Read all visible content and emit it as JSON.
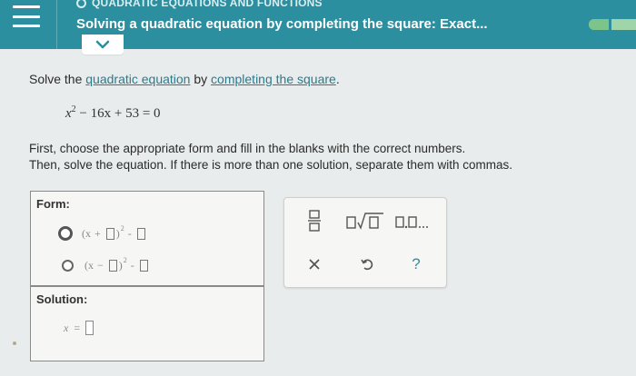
{
  "header": {
    "topic": "QUADRATIC EQUATIONS AND FUNCTIONS",
    "title": "Solving a quadratic equation by completing the square: Exact...",
    "progress": 0.35,
    "colors": {
      "bar": "#2b8fa0",
      "progress": "#7cc489"
    }
  },
  "problem": {
    "instruction_prefix": "Solve the",
    "link1": "quadratic equation",
    "instruction_mid": "by",
    "link2": "completing the square",
    "instruction_suffix": ".",
    "equation": {
      "var": "x",
      "exp": "2",
      "rest": "− 16x + 53 = 0"
    },
    "directions_line1": "First, choose the appropriate form and fill in the blanks with the correct numbers.",
    "directions_line2": "Then, solve the equation. If there is more than one solution, separate them with commas."
  },
  "answer": {
    "form_label": "Form:",
    "options": [
      {
        "open": "(x",
        "sign": "+",
        "exp": "2",
        "minus": "-"
      },
      {
        "open": "(x",
        "sign": "−",
        "exp": "2",
        "minus": "-"
      }
    ],
    "solution_label": "Solution:",
    "solution_var": "x",
    "solution_eq": "="
  },
  "tools": {
    "icons": [
      "fraction-icon",
      "sqrt-icon",
      "list-icon",
      "clear-icon",
      "undo-icon",
      "help-icon"
    ],
    "help": "?"
  }
}
